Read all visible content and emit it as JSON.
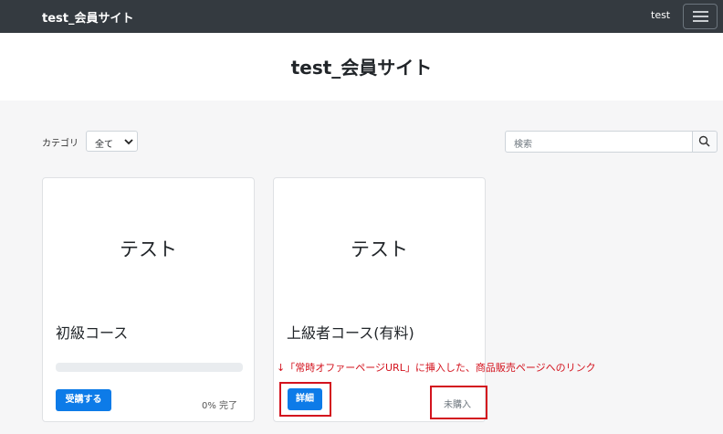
{
  "navbar": {
    "brand": "test_会員サイト",
    "user": "test"
  },
  "hero": {
    "title": "test_会員サイト"
  },
  "filter": {
    "category_label": "カテゴリ",
    "category_value": "全て",
    "search_placeholder": "検索"
  },
  "cards": [
    {
      "image_text": "テスト",
      "title": "初級コース",
      "button": "受講する",
      "progress_text": "0% 完了",
      "progress": 0
    },
    {
      "image_text": "テスト",
      "title": "上級者コース(有料)",
      "button": "詳細",
      "status": "未購入"
    }
  ],
  "annotation": "↓「常時オファーページURL」に挿入した、商品販売ページへのリンク",
  "colors": {
    "navbar": "#343a40",
    "primary": "#0d7be8",
    "highlight": "#d3131e",
    "page_bg": "#f6f6f7"
  },
  "icons": [
    "hamburger-icon",
    "chevron-down-icon",
    "search-icon"
  ]
}
